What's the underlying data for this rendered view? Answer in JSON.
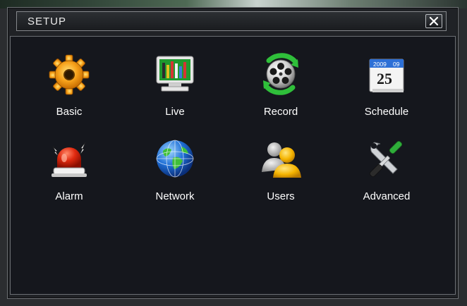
{
  "window": {
    "title": "SETUP",
    "close_icon": "close-icon"
  },
  "menu": {
    "items": [
      {
        "label": "Basic",
        "icon": "gear-icon"
      },
      {
        "label": "Live",
        "icon": "monitor-icon"
      },
      {
        "label": "Record",
        "icon": "film-reel-icon"
      },
      {
        "label": "Schedule",
        "icon": "calendar-icon",
        "calendar_year": "2009",
        "calendar_month": "09",
        "calendar_day": "25"
      },
      {
        "label": "Alarm",
        "icon": "alarm-siren-icon"
      },
      {
        "label": "Network",
        "icon": "globe-icon"
      },
      {
        "label": "Users",
        "icon": "users-icon"
      },
      {
        "label": "Advanced",
        "icon": "tools-icon"
      }
    ]
  },
  "colors": {
    "window_bg": "#202226",
    "panel_bg": "#15171d",
    "border": "#6f7276",
    "text": "#ffffff"
  }
}
